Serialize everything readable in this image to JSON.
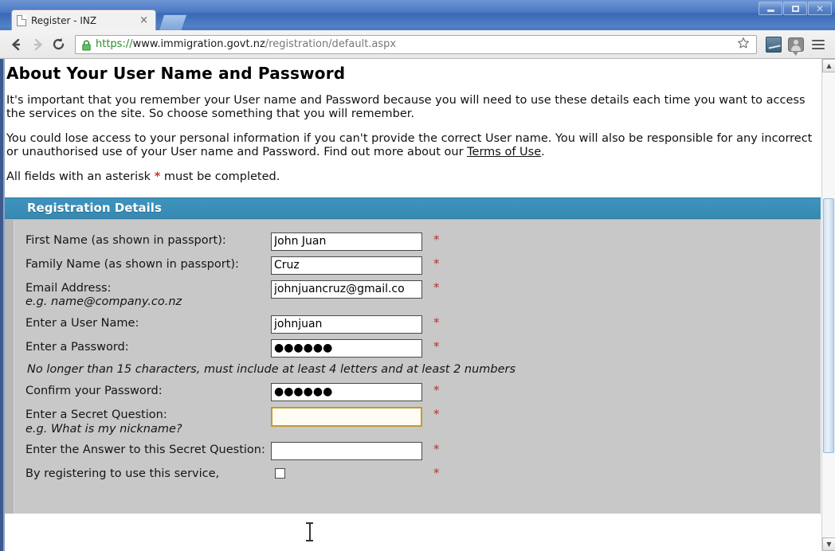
{
  "window": {
    "minimize_label": "Minimize",
    "maximize_label": "Maximize",
    "close_label": "Close"
  },
  "browser": {
    "tab": {
      "title": "Register - INZ",
      "close_label": "×",
      "favicon": "page-icon"
    },
    "new_tab_label": "",
    "nav": {
      "back_label": "Back",
      "forward_label": "Forward",
      "reload_label": "Reload"
    },
    "omnibox": {
      "scheme": "https://",
      "host": "www.immigration.govt.nz",
      "path": "/registration/default.aspx",
      "full_url": "https://www.immigration.govt.nz/registration/default.aspx",
      "lock_icon": "lock-icon",
      "bookmark_icon": "star-icon"
    },
    "extensions": [
      {
        "name": "chart-extension-icon"
      },
      {
        "name": "speech-extension-icon"
      }
    ],
    "menu_label": "Customize and control"
  },
  "page": {
    "heading": "About Your User Name and Password",
    "paragraph1": "It's important that you remember your User name and Password because you will need to use these details each time you want to access the services on the site. So choose something that you will remember.",
    "paragraph2_pre": "You could lose access to your personal information if you can't provide the correct User name. You will also be responsible for any incorrect or unauthorised use of your User name and Password. Find out more about our ",
    "paragraph2_link": "Terms of Use",
    "paragraph2_post": ".",
    "asterisk_note_pre": "All fields with an asterisk ",
    "asterisk_symbol": "*",
    "asterisk_note_post": " must be completed.",
    "section_title": "Registration Details",
    "section_color": "#3a8fb8",
    "required_marker": "*",
    "required_color": "#b5332d",
    "password_note": "No longer than 15 characters, must include at least 4 letters and at least 2 numbers",
    "fields": [
      {
        "label": "First Name (as shown in passport):",
        "hint": "",
        "value": "John Juan",
        "type": "text",
        "required": true,
        "focused": false,
        "name": "first-name-input"
      },
      {
        "label": "Family Name (as shown in passport):",
        "hint": "",
        "value": "Cruz",
        "type": "text",
        "required": true,
        "focused": false,
        "name": "family-name-input"
      },
      {
        "label": "Email Address:",
        "hint": "e.g. name@company.co.nz",
        "value": "johnjuancruz@gmail.co",
        "type": "text",
        "required": true,
        "focused": false,
        "name": "email-input"
      },
      {
        "label": "Enter a User Name:",
        "hint": "",
        "value": "johnjuan",
        "type": "text",
        "required": true,
        "focused": false,
        "name": "username-input"
      },
      {
        "label": "Enter a Password:",
        "hint": "",
        "value": "●●●●●●",
        "type": "password",
        "required": true,
        "focused": false,
        "name": "password-input"
      },
      {
        "label": "Confirm your Password:",
        "hint": "",
        "value": "●●●●●●",
        "type": "password",
        "required": true,
        "focused": false,
        "name": "confirm-password-input"
      },
      {
        "label": "Enter a Secret Question:",
        "hint": "e.g. What is my nickname?",
        "value": "",
        "type": "text",
        "required": true,
        "focused": true,
        "name": "secret-question-input"
      },
      {
        "label": "Enter the Answer to this Secret Question:",
        "hint": "",
        "value": "",
        "type": "text",
        "required": true,
        "focused": false,
        "name": "secret-answer-input"
      }
    ],
    "consent": {
      "label": "By registering to use this service,",
      "checked": false,
      "required": true
    }
  },
  "scrollbar": {
    "up_arrow": "▲",
    "down_arrow": "▼"
  }
}
